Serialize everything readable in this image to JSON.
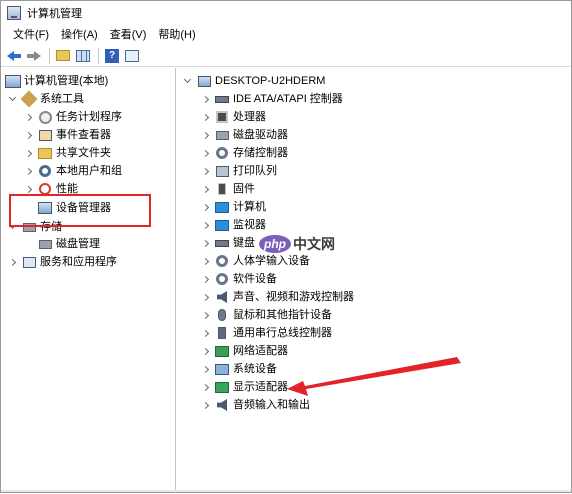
{
  "window": {
    "title": "计算机管理"
  },
  "menubar": {
    "items": [
      "文件(F)",
      "操作(A)",
      "查看(V)",
      "帮助(H)"
    ]
  },
  "toolbar": {
    "icons": [
      "back-icon",
      "forward-icon",
      "up-folder-icon",
      "show-hide-tree-icon",
      "help-icon",
      "properties-icon"
    ]
  },
  "left_tree": {
    "root": "计算机管理(本地)",
    "system_tools": "系统工具",
    "task_scheduler": "任务计划程序",
    "event_viewer": "事件查看器",
    "shared_folders": "共享文件夹",
    "local_users_groups": "本地用户和组",
    "performance": "性能",
    "device_manager": "设备管理器",
    "storage": "存储",
    "disk_management": "磁盘管理",
    "services_apps": "服务和应用程序"
  },
  "device_tree": {
    "computer": "DESKTOP-U2HDERM",
    "categories": [
      "IDE ATA/ATAPI 控制器",
      "处理器",
      "磁盘驱动器",
      "存储控制器",
      "打印队列",
      "固件",
      "计算机",
      "监视器",
      "键盘",
      "人体学输入设备",
      "软件设备",
      "声音、视频和游戏控制器",
      "鼠标和其他指针设备",
      "通用串行总线控制器",
      "网络适配器",
      "系统设备",
      "显示适配器",
      "音频输入和输出"
    ]
  },
  "watermark": {
    "logo": "php",
    "text": "中文网"
  },
  "colors": {
    "annotation_red": "#e2232a",
    "accent_blue": "#2a8fd8"
  }
}
